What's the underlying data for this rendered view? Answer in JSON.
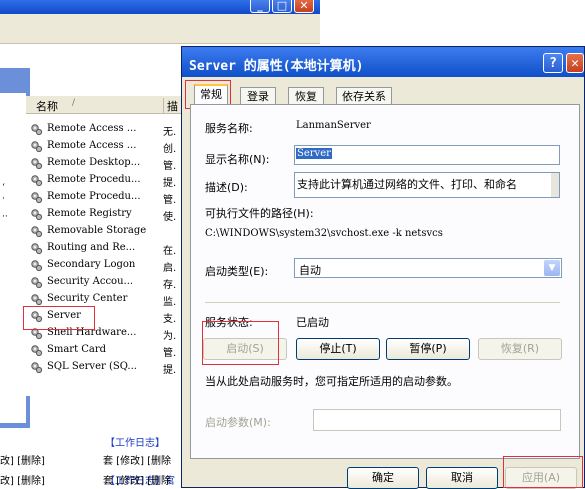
{
  "bg_window": {
    "list_header": {
      "name": "名称",
      "description": "描"
    },
    "services": [
      {
        "name": "Remote Access ...",
        "desc": "无."
      },
      {
        "name": "Remote Access ...",
        "desc": "创."
      },
      {
        "name": "Remote Desktop...",
        "desc": "管."
      },
      {
        "name": "Remote Procedu...",
        "desc": "提."
      },
      {
        "name": "Remote Procedu...",
        "desc": "管."
      },
      {
        "name": "Remote Registry",
        "desc": "使."
      },
      {
        "name": "Removable Storage",
        "desc": ""
      },
      {
        "name": "Routing and Re...",
        "desc": "在."
      },
      {
        "name": "Secondary Logon",
        "desc": "启."
      },
      {
        "name": "Security Accou...",
        "desc": "存."
      },
      {
        "name": "Security Center",
        "desc": "监."
      },
      {
        "name": "Server",
        "desc": "支."
      },
      {
        "name": "Shell Hardware...",
        "desc": "为."
      },
      {
        "name": "Smart Card",
        "desc": "管."
      },
      {
        "name": "SQL Server (SQ...",
        "desc": "提."
      }
    ],
    "left_fragments": [
      "‘",
      "·",
      "··"
    ],
    "bottom_links": [
      {
        "text": "改] [删除]"
      },
      {
        "text": "改] [删除]"
      },
      {
        "text": "【工作日志】"
      },
      {
        "text": "【工作日志】官"
      },
      {
        "text": "套 [修改] [删除"
      },
      {
        "text": "套 [修改] [删除"
      }
    ]
  },
  "dialog": {
    "title": "Server 的属性(本地计算机)",
    "help_label": "?",
    "close_label": "✕",
    "tabs": [
      "常规",
      "登录",
      "恢复",
      "依存关系"
    ],
    "service_name_label": "服务名称:",
    "service_name_value": "LanmanServer",
    "display_name_label": "显示名称(N):",
    "display_name_value": "Server",
    "description_label": "描述(D):",
    "description_value": "支持此计算机通过网络的文件、打印、和命名",
    "exe_path_label": "可执行文件的路径(H):",
    "exe_path_value": "C:\\WINDOWS\\system32\\svchost.exe -k netsvcs",
    "startup_type_label": "启动类型(E):",
    "startup_type_value": "自动",
    "status_label": "服务状态:",
    "status_value": "已启动",
    "start_button": "启动(S)",
    "stop_button": "停止(T)",
    "pause_button": "暂停(P)",
    "resume_button": "恢复(R)",
    "hint_text": "当从此处启动服务时，您可指定所适用的启动参数。",
    "start_params_label": "启动参数(M):",
    "start_params_value": "",
    "ok_button": "确定",
    "cancel_button": "取消",
    "apply_button": "应用(A)"
  },
  "colors": {
    "title_blue": "#0f4fc8",
    "highlight_red": "#e0303a",
    "selection": "#316ac5"
  }
}
